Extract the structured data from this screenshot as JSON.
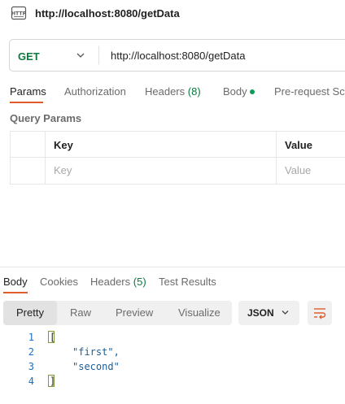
{
  "header": {
    "icon": "http-request-icon",
    "title": "http://localhost:8080/getData"
  },
  "request": {
    "method": "GET",
    "url": "http://localhost:8080/getData",
    "tabs": {
      "params": "Params",
      "authorization": "Authorization",
      "headers": "Headers",
      "headers_count": "(8)",
      "body": "Body",
      "prerequest": "Pre-request Scr"
    },
    "query_params_label": "Query Params",
    "table": {
      "key_header": "Key",
      "value_header": "Value",
      "key_placeholder": "Key",
      "value_placeholder": "Value"
    }
  },
  "response": {
    "tabs": {
      "body": "Body",
      "cookies": "Cookies",
      "headers": "Headers",
      "headers_count": "(5)",
      "test_results": "Test Results"
    },
    "view_modes": [
      "Pretty",
      "Raw",
      "Preview",
      "Visualize"
    ],
    "selected_view": "Pretty",
    "format": "JSON",
    "code_lines": [
      {
        "num": "1",
        "text": "["
      },
      {
        "num": "2",
        "text": "\"first\","
      },
      {
        "num": "3",
        "text": "\"second\""
      },
      {
        "num": "4",
        "text": "]"
      }
    ]
  },
  "colors": {
    "accent_underline": "#e05b2c",
    "method_green": "#0b7a3e",
    "string_blue": "#1b5e99",
    "line_number_blue": "#1c6ec6"
  }
}
